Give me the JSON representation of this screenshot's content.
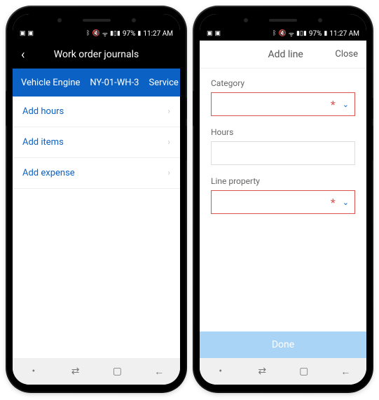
{
  "status": {
    "battery": "97%",
    "time": "11:27 AM"
  },
  "screen1": {
    "title": "Work order journals",
    "context": {
      "vehicle": "Vehicle Engine",
      "order": "NY-01-WH-3",
      "type": "Service"
    },
    "items": [
      {
        "label": "Add hours"
      },
      {
        "label": "Add items"
      },
      {
        "label": "Add expense"
      }
    ]
  },
  "screen2": {
    "title": "Add line",
    "close": "Close",
    "fields": {
      "category": {
        "label": "Category"
      },
      "hours": {
        "label": "Hours"
      },
      "line_property": {
        "label": "Line property"
      }
    },
    "done": "Done"
  }
}
